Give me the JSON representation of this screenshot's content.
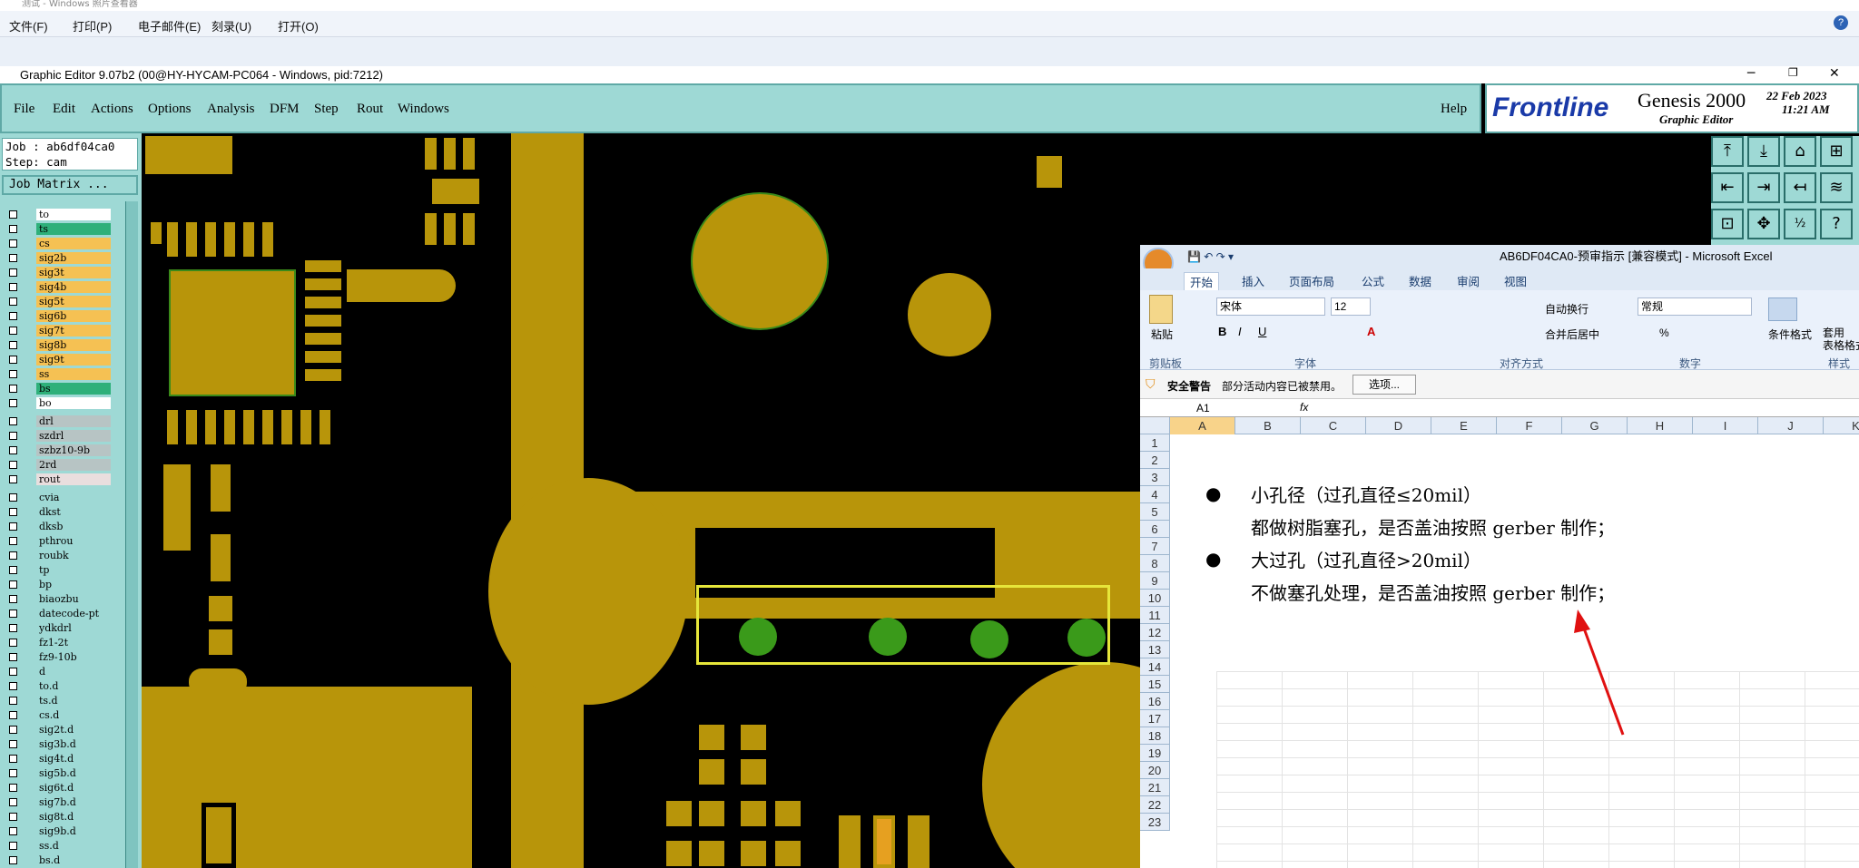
{
  "photo_viewer": {
    "title": "测试 - Windows 照片查看器",
    "menu": [
      "文件(F)",
      "打印(P)",
      "电子邮件(E)",
      "刻录(U)",
      "打开(O)"
    ]
  },
  "ge": {
    "title": "Graphic Editor 9.07b2 (00@HY-HYCAM-PC064 - Windows, pid:7212)",
    "menu": [
      "File",
      "Edit",
      "Actions",
      "Options",
      "Analysis",
      "DFM",
      "Step",
      "Rout",
      "Windows"
    ],
    "help": "Help",
    "logo": "Frontline",
    "product": "Genesis 2000",
    "subtitle": "Graphic Editor",
    "date": "22 Feb 2023",
    "time": "11:21 AM",
    "job": "Job : ab6df04ca0",
    "step": "Step: cam",
    "job_matrix": "Job Matrix ...",
    "layers": [
      {
        "name": "to",
        "color": "#ffffff"
      },
      {
        "name": "ts",
        "color": "#2eb07a"
      },
      {
        "name": "cs",
        "color": "#f5c153"
      },
      {
        "name": "sig2b",
        "color": "#f5c153"
      },
      {
        "name": "sig3t",
        "color": "#f5c153"
      },
      {
        "name": "sig4b",
        "color": "#f5c153"
      },
      {
        "name": "sig5t",
        "color": "#f5c153"
      },
      {
        "name": "sig6b",
        "color": "#f5c153"
      },
      {
        "name": "sig7t",
        "color": "#f5c153"
      },
      {
        "name": "sig8b",
        "color": "#f5c153"
      },
      {
        "name": "sig9t",
        "color": "#f5c153"
      },
      {
        "name": "ss",
        "color": "#f5c153"
      },
      {
        "name": "bs",
        "color": "#2eb07a"
      },
      {
        "name": "bo",
        "color": "#ffffff"
      },
      {
        "name": "drl",
        "color": "#b7c4c4"
      },
      {
        "name": "szdrl",
        "color": "#b7c4c4"
      },
      {
        "name": "szbz10-9b",
        "color": "#b7c4c4"
      },
      {
        "name": "2rd",
        "color": "#b7c4c4"
      },
      {
        "name": "rout",
        "color": "#e9dede"
      },
      {
        "name": "cvia",
        "color": "#9ed9d5"
      },
      {
        "name": "dkst",
        "color": "#9ed9d5"
      },
      {
        "name": "dksb",
        "color": "#9ed9d5"
      },
      {
        "name": "pthrou",
        "color": "#9ed9d5"
      },
      {
        "name": "roubk",
        "color": "#9ed9d5"
      },
      {
        "name": "tp",
        "color": "#9ed9d5"
      },
      {
        "name": "bp",
        "color": "#9ed9d5"
      },
      {
        "name": "biaozbu",
        "color": "#9ed9d5"
      },
      {
        "name": "datecode-pt",
        "color": "#9ed9d5"
      },
      {
        "name": "ydkdrl",
        "color": "#9ed9d5"
      },
      {
        "name": "fz1-2t",
        "color": "#9ed9d5"
      },
      {
        "name": "fz9-10b",
        "color": "#9ed9d5"
      },
      {
        "name": "d",
        "color": "#9ed9d5"
      },
      {
        "name": "to.d",
        "color": "#9ed9d5"
      },
      {
        "name": "ts.d",
        "color": "#9ed9d5"
      },
      {
        "name": "cs.d",
        "color": "#9ed9d5"
      },
      {
        "name": "sig2t.d",
        "color": "#9ed9d5"
      },
      {
        "name": "sig3b.d",
        "color": "#9ed9d5"
      },
      {
        "name": "sig4t.d",
        "color": "#9ed9d5"
      },
      {
        "name": "sig5b.d",
        "color": "#9ed9d5"
      },
      {
        "name": "sig6t.d",
        "color": "#9ed9d5"
      },
      {
        "name": "sig7b.d",
        "color": "#9ed9d5"
      },
      {
        "name": "sig8t.d",
        "color": "#9ed9d5"
      },
      {
        "name": "sig9b.d",
        "color": "#9ed9d5"
      },
      {
        "name": "ss.d",
        "color": "#9ed9d5"
      },
      {
        "name": "bs.d",
        "color": "#9ed9d5"
      }
    ]
  },
  "excel": {
    "title": "AB6DF04CA0-预审指示 [兼容模式] - Microsoft Excel",
    "tabs": [
      "开始",
      "插入",
      "页面布局",
      "公式",
      "数据",
      "审阅",
      "视图"
    ],
    "font_name": "宋体",
    "font_size": "12",
    "number_format": "常规",
    "group_labels": [
      "剪贴板",
      "字体",
      "对齐方式",
      "数字",
      "样式"
    ],
    "paste": "粘贴",
    "wrap": "自动换行",
    "merge": "合并后居中",
    "cond_format": "条件格式",
    "table_format": "套用\n表格格式",
    "security_title": "安全警告",
    "security_msg": "部分活动内容已被禁用。",
    "options_btn": "选项...",
    "name_box": "A1",
    "fx": "fx",
    "columns": [
      "A",
      "B",
      "C",
      "D",
      "E",
      "F",
      "G",
      "H",
      "I",
      "J",
      "K"
    ],
    "rows": [
      "1",
      "2",
      "3",
      "4",
      "5",
      "6",
      "7",
      "8",
      "9",
      "10",
      "11",
      "12",
      "13",
      "14",
      "15",
      "16",
      "17",
      "18",
      "19",
      "20",
      "21",
      "22",
      "23"
    ],
    "notes": [
      "小孔径（过孔直径≤20mil）",
      "都做树脂塞孔，是否盖油按照 gerber 制作；",
      "大过孔（过孔直径>20mil）",
      "不做塞孔处理，是否盖油按照 gerber 制作；"
    ]
  }
}
